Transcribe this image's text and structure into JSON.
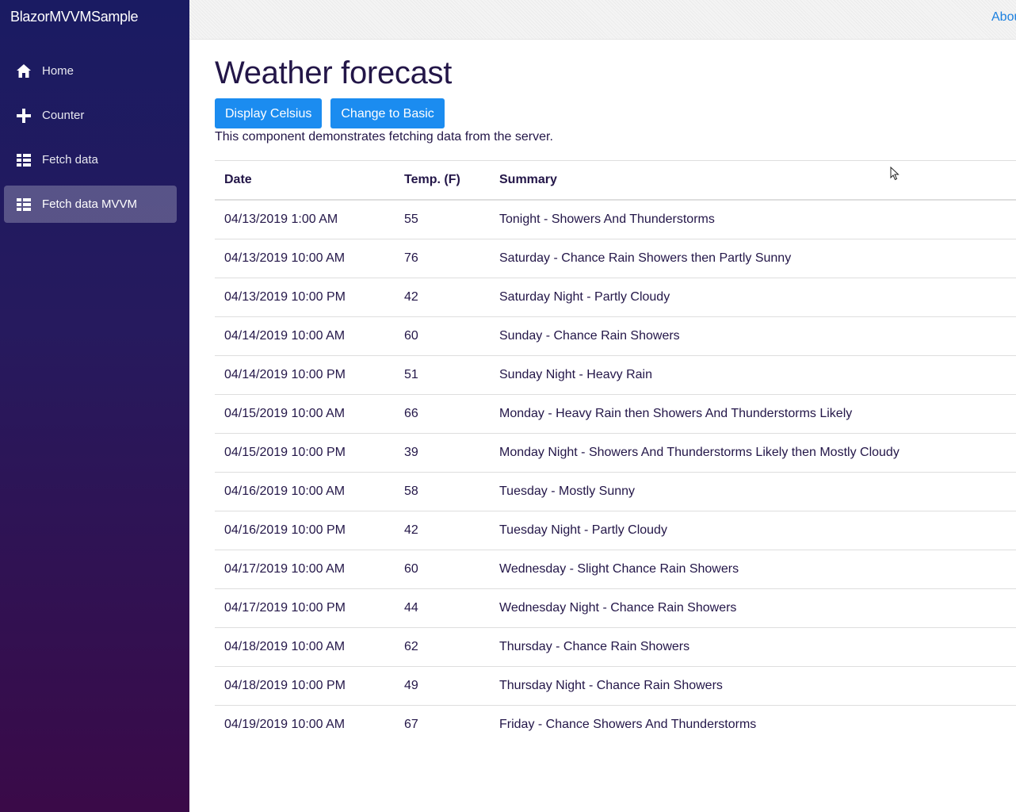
{
  "brand": "BlazorMVVMSample",
  "topbar": {
    "about_label": "About"
  },
  "nav": [
    {
      "label": "Home",
      "icon": "home-icon"
    },
    {
      "label": "Counter",
      "icon": "plus-icon"
    },
    {
      "label": "Fetch data",
      "icon": "list-icon"
    },
    {
      "label": "Fetch data MVVM",
      "icon": "list-icon",
      "active": true
    }
  ],
  "page": {
    "title": "Weather forecast",
    "celsius_button": "Display Celsius",
    "basic_button": "Change to Basic",
    "description": "This component demonstrates fetching data from the server."
  },
  "table": {
    "headers": [
      "Date",
      "Temp. (F)",
      "Summary"
    ],
    "rows": [
      {
        "date": "04/13/2019 1:00 AM",
        "temp": "55",
        "summary": "Tonight - Showers And Thunderstorms"
      },
      {
        "date": "04/13/2019 10:00 AM",
        "temp": "76",
        "summary": "Saturday - Chance Rain Showers then Partly Sunny"
      },
      {
        "date": "04/13/2019 10:00 PM",
        "temp": "42",
        "summary": "Saturday Night - Partly Cloudy"
      },
      {
        "date": "04/14/2019 10:00 AM",
        "temp": "60",
        "summary": "Sunday - Chance Rain Showers"
      },
      {
        "date": "04/14/2019 10:00 PM",
        "temp": "51",
        "summary": "Sunday Night - Heavy Rain"
      },
      {
        "date": "04/15/2019 10:00 AM",
        "temp": "66",
        "summary": "Monday - Heavy Rain then Showers And Thunderstorms Likely"
      },
      {
        "date": "04/15/2019 10:00 PM",
        "temp": "39",
        "summary": "Monday Night - Showers And Thunderstorms Likely then Mostly Cloudy"
      },
      {
        "date": "04/16/2019 10:00 AM",
        "temp": "58",
        "summary": "Tuesday - Mostly Sunny"
      },
      {
        "date": "04/16/2019 10:00 PM",
        "temp": "42",
        "summary": "Tuesday Night - Partly Cloudy"
      },
      {
        "date": "04/17/2019 10:00 AM",
        "temp": "60",
        "summary": "Wednesday - Slight Chance Rain Showers"
      },
      {
        "date": "04/17/2019 10:00 PM",
        "temp": "44",
        "summary": "Wednesday Night - Chance Rain Showers"
      },
      {
        "date": "04/18/2019 10:00 AM",
        "temp": "62",
        "summary": "Thursday - Chance Rain Showers"
      },
      {
        "date": "04/18/2019 10:00 PM",
        "temp": "49",
        "summary": "Thursday Night - Chance Rain Showers"
      },
      {
        "date": "04/19/2019 10:00 AM",
        "temp": "67",
        "summary": "Friday - Chance Showers And Thunderstorms"
      }
    ]
  },
  "colors": {
    "sidebar_top": "#1a1b62",
    "sidebar_bottom": "#3a0a48",
    "button": "#1b8cf0",
    "link": "#1b80e0",
    "text": "#231648"
  }
}
